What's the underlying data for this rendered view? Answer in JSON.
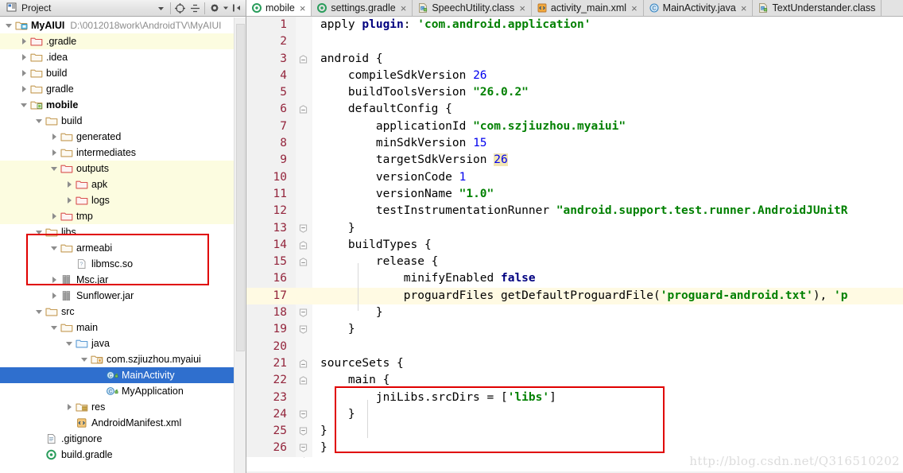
{
  "panel": {
    "title": "Project",
    "toolbar": [
      {
        "name": "panel-dropdown-icon",
        "glyph": "▾"
      },
      {
        "name": "locate-target-icon",
        "glyph": "⊕"
      },
      {
        "name": "collapse-all-icon",
        "glyph": "÷"
      },
      {
        "name": "settings-gear-icon",
        "glyph": "✱"
      },
      {
        "name": "settings-dropdown-icon",
        "glyph": "▾"
      },
      {
        "name": "hide-panel-icon",
        "glyph": "|←"
      }
    ],
    "tree": [
      {
        "label": "MyAIUI",
        "path": "D:\\0012018work\\AndroidTV\\MyAIUI",
        "depth": 0,
        "arrow": "down",
        "icon": "module-root",
        "bold": true,
        "state": "normal"
      },
      {
        "label": ".gradle",
        "depth": 1,
        "arrow": "right",
        "icon": "folder-red",
        "state": "yellow"
      },
      {
        "label": ".idea",
        "depth": 1,
        "arrow": "right",
        "icon": "folder-tan",
        "state": "normal"
      },
      {
        "label": "build",
        "depth": 1,
        "arrow": "right",
        "icon": "folder-tan",
        "state": "normal"
      },
      {
        "label": "gradle",
        "depth": 1,
        "arrow": "right",
        "icon": "folder-tan",
        "state": "normal"
      },
      {
        "label": "mobile",
        "depth": 1,
        "arrow": "down",
        "icon": "module-android",
        "bold": true,
        "state": "normal"
      },
      {
        "label": "build",
        "depth": 2,
        "arrow": "down",
        "icon": "folder-tan",
        "state": "normal"
      },
      {
        "label": "generated",
        "depth": 3,
        "arrow": "right",
        "icon": "folder-tan",
        "state": "normal"
      },
      {
        "label": "intermediates",
        "depth": 3,
        "arrow": "right",
        "icon": "folder-tan",
        "state": "normal"
      },
      {
        "label": "outputs",
        "depth": 3,
        "arrow": "down",
        "icon": "folder-red",
        "state": "yellow"
      },
      {
        "label": "apk",
        "depth": 4,
        "arrow": "right",
        "icon": "folder-red",
        "state": "yellow"
      },
      {
        "label": "logs",
        "depth": 4,
        "arrow": "right",
        "icon": "folder-red",
        "state": "yellow"
      },
      {
        "label": "tmp",
        "depth": 3,
        "arrow": "right",
        "icon": "folder-red",
        "state": "yellow"
      },
      {
        "label": "libs",
        "depth": 2,
        "arrow": "down",
        "icon": "folder-tan",
        "state": "normal"
      },
      {
        "label": "armeabi",
        "depth": 3,
        "arrow": "down",
        "icon": "folder-tan",
        "state": "normal"
      },
      {
        "label": "libmsc.so",
        "depth": 4,
        "arrow": "none",
        "icon": "file-unknown",
        "state": "normal"
      },
      {
        "label": "Msc.jar",
        "depth": 3,
        "arrow": "right",
        "icon": "jar",
        "state": "normal"
      },
      {
        "label": "Sunflower.jar",
        "depth": 3,
        "arrow": "right",
        "icon": "jar",
        "state": "normal"
      },
      {
        "label": "src",
        "depth": 2,
        "arrow": "down",
        "icon": "folder-tan",
        "state": "normal"
      },
      {
        "label": "main",
        "depth": 3,
        "arrow": "down",
        "icon": "folder-tan",
        "state": "normal"
      },
      {
        "label": "java",
        "depth": 4,
        "arrow": "down",
        "icon": "folder-blue",
        "state": "normal"
      },
      {
        "label": "com.szjiuzhou.myaiui",
        "depth": 5,
        "arrow": "down",
        "icon": "package",
        "state": "normal"
      },
      {
        "label": "MainActivity",
        "depth": 6,
        "arrow": "none",
        "icon": "java-class",
        "state": "selected"
      },
      {
        "label": "MyApplication",
        "depth": 6,
        "arrow": "none",
        "icon": "java-class",
        "state": "normal"
      },
      {
        "label": "res",
        "depth": 4,
        "arrow": "right",
        "icon": "folder-res",
        "state": "normal"
      },
      {
        "label": "AndroidManifest.xml",
        "depth": 4,
        "arrow": "none",
        "icon": "manifest-xml",
        "state": "normal"
      },
      {
        "label": ".gitignore",
        "depth": 2,
        "arrow": "none",
        "icon": "file-text",
        "state": "normal"
      },
      {
        "label": "build.gradle",
        "depth": 2,
        "arrow": "none",
        "icon": "gradle-file",
        "state": "normal"
      }
    ]
  },
  "tabs": [
    {
      "label": "mobile",
      "icon": "gradle-icon",
      "active": true,
      "close": "×"
    },
    {
      "label": "settings.gradle",
      "icon": "gradle-icon",
      "active": false,
      "close": "×"
    },
    {
      "label": "SpeechUtility.class",
      "icon": "class-file-icon",
      "active": false,
      "close": "×"
    },
    {
      "label": "activity_main.xml",
      "icon": "android-xml-icon",
      "active": false,
      "close": "×"
    },
    {
      "label": "MainActivity.java",
      "icon": "java-class-icon",
      "active": false,
      "close": "×"
    },
    {
      "label": "TextUnderstander.class",
      "icon": "class-file-icon",
      "active": false,
      "close": ""
    }
  ],
  "editor": {
    "current_line": 17,
    "lines": [
      {
        "n": 1,
        "fold": "",
        "tokens": [
          {
            "t": "apply ",
            "c": "pln"
          },
          {
            "t": "plugin",
            "c": "kw"
          },
          {
            "t": ": ",
            "c": "pln"
          },
          {
            "t": "'com.android.application'",
            "c": "str"
          }
        ]
      },
      {
        "n": 2,
        "fold": "",
        "tokens": [
          {
            "t": "",
            "c": "pln"
          }
        ]
      },
      {
        "n": 3,
        "fold": "open",
        "tokens": [
          {
            "t": "android {",
            "c": "pln"
          }
        ]
      },
      {
        "n": 4,
        "fold": "",
        "tokens": [
          {
            "t": "    compileSdkVersion ",
            "c": "pln"
          },
          {
            "t": "26",
            "c": "num"
          }
        ]
      },
      {
        "n": 5,
        "fold": "",
        "tokens": [
          {
            "t": "    buildToolsVersion ",
            "c": "pln"
          },
          {
            "t": "\"26.0.2\"",
            "c": "str"
          }
        ]
      },
      {
        "n": 6,
        "fold": "open",
        "tokens": [
          {
            "t": "    defaultConfig {",
            "c": "pln"
          }
        ]
      },
      {
        "n": 7,
        "fold": "",
        "tokens": [
          {
            "t": "        applicationId ",
            "c": "pln"
          },
          {
            "t": "\"com.szjiuzhou.myaiui\"",
            "c": "str"
          }
        ]
      },
      {
        "n": 8,
        "fold": "",
        "tokens": [
          {
            "t": "        minSdkVersion ",
            "c": "pln"
          },
          {
            "t": "15",
            "c": "num"
          }
        ]
      },
      {
        "n": 9,
        "fold": "",
        "tokens": [
          {
            "t": "        targetSdkVersion ",
            "c": "pln"
          },
          {
            "t": "26",
            "c": "hlnum"
          }
        ]
      },
      {
        "n": 10,
        "fold": "",
        "tokens": [
          {
            "t": "        versionCode ",
            "c": "pln"
          },
          {
            "t": "1",
            "c": "num"
          }
        ]
      },
      {
        "n": 11,
        "fold": "",
        "tokens": [
          {
            "t": "        versionName ",
            "c": "pln"
          },
          {
            "t": "\"1.0\"",
            "c": "str"
          }
        ]
      },
      {
        "n": 12,
        "fold": "",
        "tokens": [
          {
            "t": "        testInstrumentationRunner ",
            "c": "pln"
          },
          {
            "t": "\"android.support.test.runner.AndroidJUnitR",
            "c": "str"
          }
        ]
      },
      {
        "n": 13,
        "fold": "close",
        "tokens": [
          {
            "t": "    }",
            "c": "pln"
          }
        ]
      },
      {
        "n": 14,
        "fold": "open",
        "tokens": [
          {
            "t": "    buildTypes {",
            "c": "pln"
          }
        ]
      },
      {
        "n": 15,
        "fold": "open",
        "tokens": [
          {
            "t": "        release {",
            "c": "pln"
          }
        ]
      },
      {
        "n": 16,
        "fold": "",
        "tokens": [
          {
            "t": "            minifyEnabled ",
            "c": "pln"
          },
          {
            "t": "false",
            "c": "kw"
          }
        ]
      },
      {
        "n": 17,
        "fold": "",
        "tokens": [
          {
            "t": "            proguardFiles getDefaultProguardFile(",
            "c": "pln"
          },
          {
            "t": "'proguard-android.txt'",
            "c": "str"
          },
          {
            "t": "), ",
            "c": "pln"
          },
          {
            "t": "'p",
            "c": "str"
          }
        ]
      },
      {
        "n": 18,
        "fold": "close",
        "tokens": [
          {
            "t": "        }",
            "c": "pln"
          }
        ]
      },
      {
        "n": 19,
        "fold": "close",
        "tokens": [
          {
            "t": "    }",
            "c": "pln"
          }
        ]
      },
      {
        "n": 20,
        "fold": "",
        "tokens": [
          {
            "t": "",
            "c": "pln"
          }
        ]
      },
      {
        "n": 21,
        "fold": "open",
        "tokens": [
          {
            "t": "sourceSets {",
            "c": "pln"
          }
        ]
      },
      {
        "n": 22,
        "fold": "open",
        "tokens": [
          {
            "t": "    main {",
            "c": "pln"
          }
        ]
      },
      {
        "n": 23,
        "fold": "",
        "tokens": [
          {
            "t": "        jniLibs.srcDirs = [",
            "c": "pln"
          },
          {
            "t": "'libs'",
            "c": "str"
          },
          {
            "t": "]",
            "c": "pln"
          }
        ]
      },
      {
        "n": 24,
        "fold": "close",
        "tokens": [
          {
            "t": "    }",
            "c": "pln"
          }
        ]
      },
      {
        "n": 25,
        "fold": "close",
        "tokens": [
          {
            "t": "}",
            "c": "pln"
          }
        ]
      },
      {
        "n": 26,
        "fold": "close",
        "tokens": [
          {
            "t": "}",
            "c": "pln"
          }
        ]
      }
    ]
  },
  "annotations": {
    "watermark": "http://blog.csdn.net/Q316510202",
    "box_color": "#e00000",
    "tree_box_label": "libs-armeabi-libmsc-highlight",
    "code_box_label": "sourcesets-block-highlight"
  },
  "colors": {
    "selection_blue": "#2f6fce",
    "highlight_yellow": "#fcfce0",
    "current_line": "#fffae3",
    "gutter_text": "#93243b",
    "string_green": "#008000",
    "keyword_navy": "#000080",
    "number_blue": "#0000ee"
  }
}
